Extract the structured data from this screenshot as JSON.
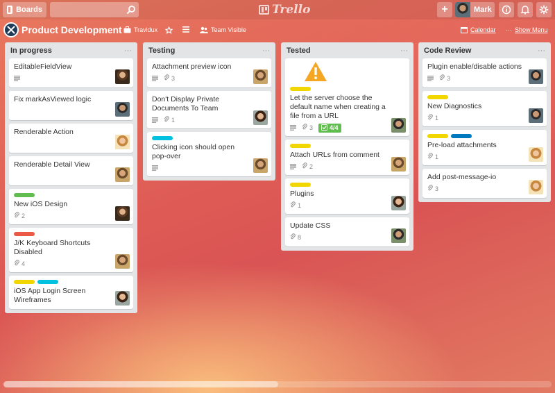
{
  "header": {
    "boards_label": "Boards",
    "search_value": "",
    "logo_text": "Trello",
    "user_name": "Mark"
  },
  "board": {
    "title": "Product Development",
    "org": "Travidux",
    "visibility": "Team Visible",
    "calendar": "Calendar",
    "show_menu": "Show Menu"
  },
  "lists": [
    {
      "title": "In progress",
      "cards": [
        {
          "title": "EditableFieldView",
          "desc": true,
          "avatar": "av-a"
        },
        {
          "title": "Fix markAsViewed logic",
          "avatar": "av-b"
        },
        {
          "title": "Renderable Action",
          "avatar": "av-c"
        },
        {
          "title": "Renderable Detail View",
          "avatar": "av-d"
        },
        {
          "title": "New iOS Design",
          "labels": [
            "green"
          ],
          "attachments": "2",
          "avatar": "av-a"
        },
        {
          "title": "J/K Keyboard Shortcuts Disabled",
          "labels": [
            "red"
          ],
          "attachments": "4",
          "avatar": "av-d"
        },
        {
          "title": "iOS App Login Screen Wireframes",
          "labels": [
            "yellow",
            "cyan"
          ],
          "avatar": "av-e"
        }
      ]
    },
    {
      "title": "Testing",
      "cards": [
        {
          "title": "Attachment preview icon",
          "desc": true,
          "attachments": "3",
          "avatar": "av-d"
        },
        {
          "title": "Don't Display Private Documents To Team",
          "desc": true,
          "attachments": "1",
          "avatar": "av-e"
        },
        {
          "title": "Clicking icon should open pop-over",
          "labels": [
            "cyan"
          ],
          "desc": true,
          "avatar": "av-d"
        }
      ]
    },
    {
      "title": "Tested",
      "cards": [
        {
          "title": "Let the server choose the default name when creating a file from a URL",
          "warning": true,
          "labels": [
            "yellow"
          ],
          "desc": true,
          "attachments": "3",
          "checklist": "4/4",
          "avatar": "av-f"
        },
        {
          "title": "Attach URLs from comment",
          "labels": [
            "yellow"
          ],
          "desc": true,
          "attachments": "2",
          "avatar": "av-d"
        },
        {
          "title": "Plugins",
          "labels": [
            "yellow"
          ],
          "attachments": "1",
          "avatar": "av-e"
        },
        {
          "title": "Update CSS",
          "attachments": "8",
          "avatar": "av-f"
        }
      ]
    },
    {
      "title": "Code Review",
      "cards": [
        {
          "title": "Plugin enable/disable actions",
          "desc": true,
          "attachments": "3",
          "avatar": "av-b"
        },
        {
          "title": "New Diagnostics",
          "labels": [
            "yellow"
          ],
          "attachments": "1",
          "avatar": "av-b"
        },
        {
          "title": "Pre-load attachments",
          "labels": [
            "yellow",
            "blue"
          ],
          "attachments": "1",
          "avatar": "av-c"
        },
        {
          "title": "Add post-message-io",
          "attachments": "3",
          "avatar": "av-c"
        }
      ]
    }
  ]
}
